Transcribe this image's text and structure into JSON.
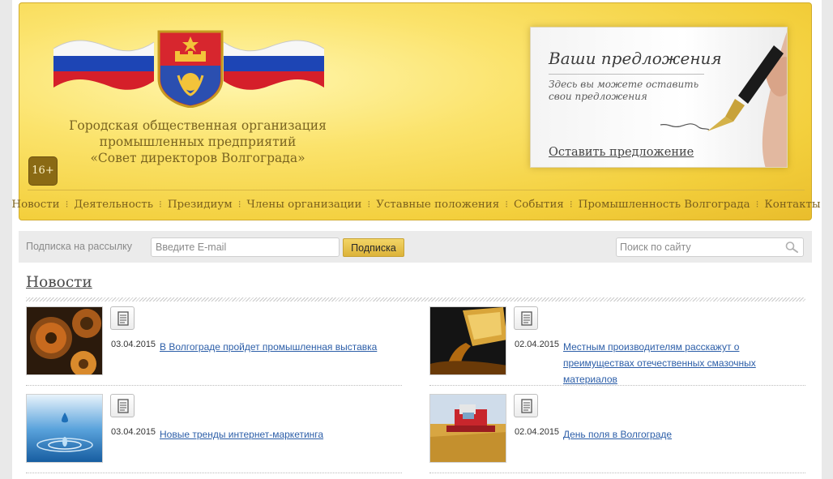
{
  "header": {
    "org_name": {
      "line1": "Городская общественная организация",
      "line2": "промышленных предприятий",
      "line3": "«Совет директоров Волгограда»"
    },
    "age_rating": "16+",
    "proposal": {
      "title": "Ваши предложения",
      "text": "Здесь вы можете оставить свои предложения",
      "link": "Оставить предложение"
    }
  },
  "nav": {
    "items": [
      {
        "label": "Новости"
      },
      {
        "label": "Деятельность"
      },
      {
        "label": "Президиум"
      },
      {
        "label": "Члены организации"
      },
      {
        "label": "Уставные положения"
      },
      {
        "label": "События"
      },
      {
        "label": "Промышленность Волгограда"
      },
      {
        "label": "Контакты"
      }
    ],
    "separator": "⁝"
  },
  "subscribe": {
    "label": "Подписка на рассылку",
    "email_placeholder": "Введите E-mail",
    "button": "Подписка",
    "search_placeholder": "Поиск по сайту"
  },
  "news": {
    "heading": "Новости",
    "items": [
      {
        "date": "03.04.2015",
        "title": "В Волгограде пройдет промышленная выставка",
        "image": "gears-image"
      },
      {
        "date": "02.04.2015",
        "title": "Местным производителям расскажут о преимуществах отечественных смазочных материалов",
        "image": "oil-image"
      },
      {
        "date": "03.04.2015",
        "title": "Новые тренды интернет-маркетинга",
        "image": "water-drop-image"
      },
      {
        "date": "02.04.2015",
        "title": "День поля в Волгограде",
        "image": "harvester-image"
      }
    ]
  },
  "colors": {
    "header_gold": "#f3cf3c",
    "nav_text": "#7a5f1c",
    "link_blue": "#2c5ea8",
    "button_gold": "#dcb33a",
    "age_badge": "#8a6a14"
  }
}
